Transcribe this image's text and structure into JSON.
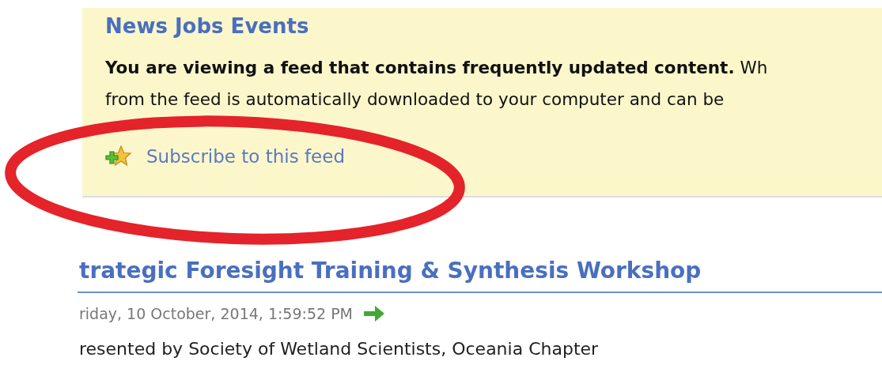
{
  "feed_banner": {
    "title": "News Jobs Events",
    "lines": [
      "**You are viewing a feed that contains frequently updated content.** Wh",
      "from the feed is automatically downloaded to your computer and can be"
    ],
    "subscribe_link": "Subscribe to this feed"
  },
  "entry": {
    "title": "trategic Foresight Training & Synthesis Workshop",
    "date": "riday, 10 October, 2014, 1:59:52 PM",
    "body": "resented by Society of Wetland Scientists, Oceania Chapter"
  }
}
